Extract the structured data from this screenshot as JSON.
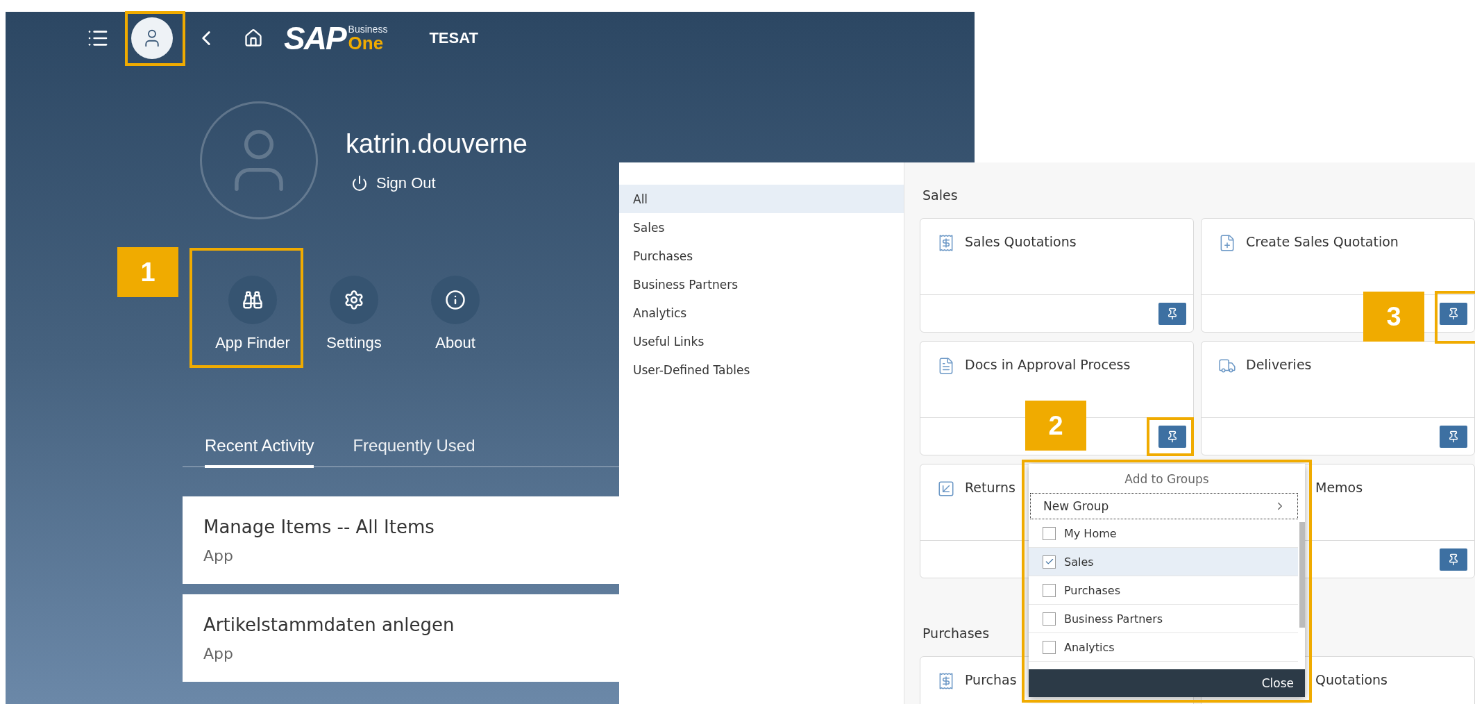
{
  "shell": {
    "title": "TESAT",
    "logo": {
      "main": "SAP",
      "top": "Business",
      "bottom": "One"
    }
  },
  "user": {
    "name": "katrin.douverne",
    "sign_out": "Sign Out"
  },
  "actions": [
    {
      "label": "App Finder",
      "kind": "finder"
    },
    {
      "label": "Settings",
      "kind": "settings"
    },
    {
      "label": "About",
      "kind": "about"
    }
  ],
  "tabs": [
    {
      "label": "Recent Activity",
      "selected": true
    },
    {
      "label": "Frequently Used",
      "selected": false
    }
  ],
  "recent": [
    {
      "title": "Manage Items -- All Items",
      "type": "App"
    },
    {
      "title": "Artikelstammdaten anlegen",
      "type": "App"
    }
  ],
  "app_finder": {
    "categories": [
      {
        "label": "All",
        "selected": true
      },
      {
        "label": "Sales",
        "selected": false
      },
      {
        "label": "Purchases",
        "selected": false
      },
      {
        "label": "Business Partners",
        "selected": false
      },
      {
        "label": "Analytics",
        "selected": false
      },
      {
        "label": "Useful Links",
        "selected": false
      },
      {
        "label": "User-Defined Tables",
        "selected": false
      }
    ],
    "sections": [
      {
        "title": "Sales",
        "tiles": [
          {
            "title": "Sales Quotations",
            "kind": "quote"
          },
          {
            "title": "Create Sales Quotation",
            "kind": "create"
          },
          {
            "title": "Docs in Approval Process",
            "kind": "doc"
          },
          {
            "title": "Deliveries",
            "kind": "truck"
          },
          {
            "title": "Returns",
            "kind": "returns"
          },
          {
            "title": "Memos",
            "kind": "covered"
          }
        ]
      },
      {
        "title": "Purchases",
        "tiles": [
          {
            "title": "Purchas",
            "kind": "quote"
          },
          {
            "title": "Quotations",
            "kind": "covered"
          }
        ]
      }
    ]
  },
  "popover": {
    "title": "Add to Groups",
    "new_group": "New Group",
    "groups": [
      {
        "label": "My Home",
        "checked": false,
        "selected": false
      },
      {
        "label": "Sales",
        "checked": true,
        "selected": true
      },
      {
        "label": "Purchases",
        "checked": false,
        "selected": false
      },
      {
        "label": "Business Partners",
        "checked": false,
        "selected": false
      },
      {
        "label": "Analytics",
        "checked": false,
        "selected": false
      }
    ],
    "close": "Close"
  },
  "callouts": [
    "1",
    "2",
    "3"
  ]
}
